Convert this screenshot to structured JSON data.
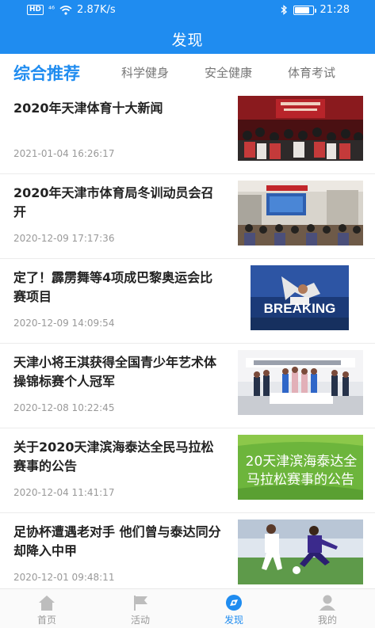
{
  "status_bar": {
    "hd": "HD",
    "signal": "⁴⁶",
    "speed": "2.87K/s",
    "time": "21:28",
    "battery_level": 0.8
  },
  "header": {
    "title": "发现"
  },
  "tabs": [
    {
      "label": "综合推荐",
      "active": true
    },
    {
      "label": "科学健身",
      "active": false
    },
    {
      "label": "安全健康",
      "active": false
    },
    {
      "label": "体育考试",
      "active": false
    }
  ],
  "articles": [
    {
      "title": "2020年天津体育十大新闻",
      "time": "2021-01-04 16:26:17"
    },
    {
      "title": "2020年天津市体育局冬训动员会召开",
      "time": "2020-12-09 17:17:36"
    },
    {
      "title": "定了！霹雳舞等4项成巴黎奥运会比赛项目",
      "time": "2020-12-09 14:09:54",
      "thumb_text": "BREAKING"
    },
    {
      "title": "天津小将王淇获得全国青少年艺术体操锦标赛个人冠军",
      "time": "2020-12-08 10:22:45"
    },
    {
      "title": "关于2020天津滨海泰达全民马拉松赛事的公告",
      "time": "2020-12-04 11:41:17",
      "thumb_text_1": "20天津滨海泰达全",
      "thumb_text_2": "马拉松赛事的公告"
    },
    {
      "title": "足协杯遭遇老对手 他们曾与泰达同分却降入中甲",
      "time": "2020-12-01 09:48:11"
    }
  ],
  "tabbar": [
    {
      "label": "首页",
      "icon": "home-icon",
      "active": false
    },
    {
      "label": "活动",
      "icon": "flag-icon",
      "active": false
    },
    {
      "label": "发现",
      "icon": "compass-icon",
      "active": true
    },
    {
      "label": "我的",
      "icon": "user-icon",
      "active": false
    }
  ],
  "colors": {
    "accent": "#1f8cf0",
    "text": "#222222",
    "muted": "#999999"
  }
}
